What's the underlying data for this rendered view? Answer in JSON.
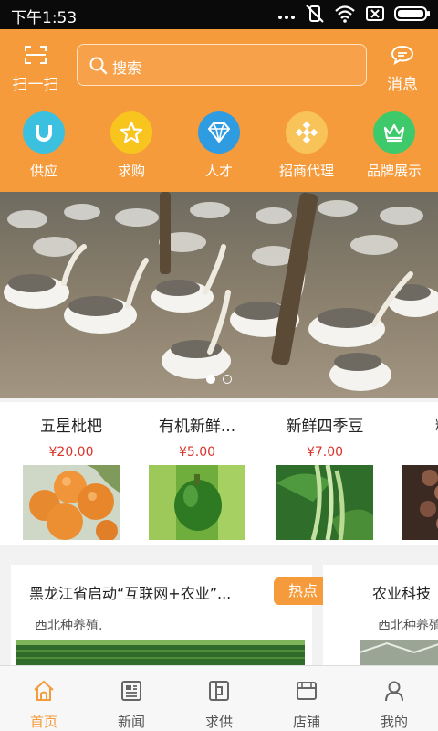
{
  "status_bar": {
    "time": "下午1:53"
  },
  "header": {
    "scan_label": "扫一扫",
    "search_placeholder": "搜索",
    "message_label": "消息"
  },
  "categories": [
    {
      "label": "供应",
      "icon": "magnet-icon",
      "color": "#3cc0e0"
    },
    {
      "label": "求购",
      "icon": "star-icon",
      "color": "#f7c51e"
    },
    {
      "label": "人才",
      "icon": "diamond-icon",
      "color": "#2f9ce2"
    },
    {
      "label": "招商代理",
      "icon": "grid-icon",
      "color": "#f8c45a"
    },
    {
      "label": "品牌展示",
      "icon": "crown-icon",
      "color": "#3ec96a"
    }
  ],
  "banner": {
    "dots": 2,
    "active_dot": 1
  },
  "products": [
    {
      "name": "五星枇杷",
      "price": "¥20.00"
    },
    {
      "name": "有机新鲜...",
      "price": "¥5.00"
    },
    {
      "name": "新鲜四季豆",
      "price": "¥7.00"
    },
    {
      "name": "精选",
      "price": "¥"
    }
  ],
  "news": [
    {
      "title": "黑龙江省启动“互联网+农业”...",
      "badge": "热点",
      "source": "西北种养殖."
    },
    {
      "title": "农业科技",
      "source": "西北种养殖"
    }
  ],
  "tabbar": [
    {
      "label": "首页",
      "icon": "home-icon",
      "active": true
    },
    {
      "label": "新闻",
      "icon": "news-icon",
      "active": false
    },
    {
      "label": "求供",
      "icon": "supply-icon",
      "active": false
    },
    {
      "label": "店铺",
      "icon": "shop-icon",
      "active": false
    },
    {
      "label": "我的",
      "icon": "user-icon",
      "active": false
    }
  ],
  "colors": {
    "accent": "#f59b3c",
    "price": "#d8342b"
  }
}
